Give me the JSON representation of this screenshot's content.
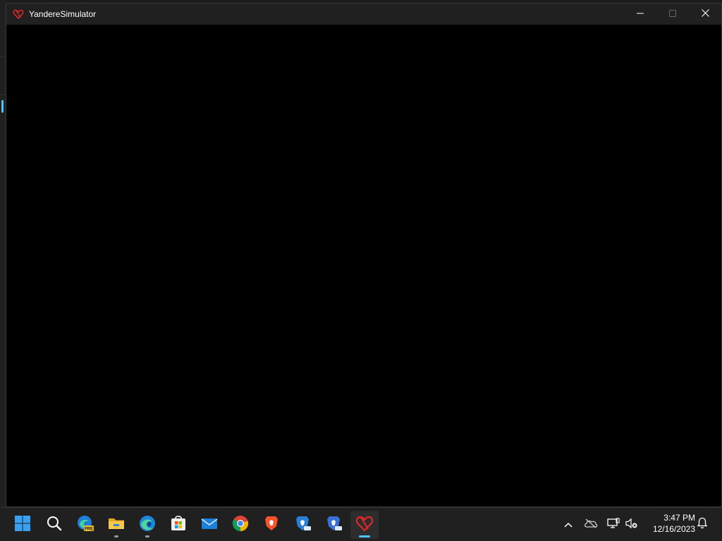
{
  "window": {
    "title": "YandereSimulator",
    "icon": "yandere-heart-icon",
    "controls": [
      "minimize",
      "maximize",
      "close"
    ]
  },
  "taskbar": {
    "pinned": [
      {
        "name": "start",
        "icon": "windows-logo-icon"
      },
      {
        "name": "search",
        "icon": "search-icon"
      },
      {
        "name": "edge-preview",
        "icon": "edge-preview-icon",
        "badge": "PRE"
      },
      {
        "name": "file-explorer",
        "icon": "folder-icon",
        "running": true
      },
      {
        "name": "edge",
        "icon": "edge-icon",
        "running": true
      },
      {
        "name": "microsoft-store",
        "icon": "store-icon"
      },
      {
        "name": "mail",
        "icon": "mail-icon"
      },
      {
        "name": "chrome",
        "icon": "chrome-icon"
      },
      {
        "name": "brave",
        "icon": "brave-icon"
      },
      {
        "name": "brave-beta",
        "icon": "brave-beta-icon"
      },
      {
        "name": "brave-nightly",
        "icon": "brave-nightly-icon"
      },
      {
        "name": "yandere-simulator",
        "icon": "yandere-heart-icon",
        "running": true,
        "active": true
      }
    ],
    "tray": {
      "icons": [
        "chevron-up-icon",
        "onedrive-offline-icon",
        "network-icon",
        "volume-muted-icon",
        "notification-bell-icon"
      ],
      "time": "3:47 PM",
      "date": "12/16/2023"
    }
  },
  "colors": {
    "accent": "#4cc2ff",
    "titlebar": "#202020",
    "client": "#000000",
    "yandere_red": "#e02626"
  }
}
